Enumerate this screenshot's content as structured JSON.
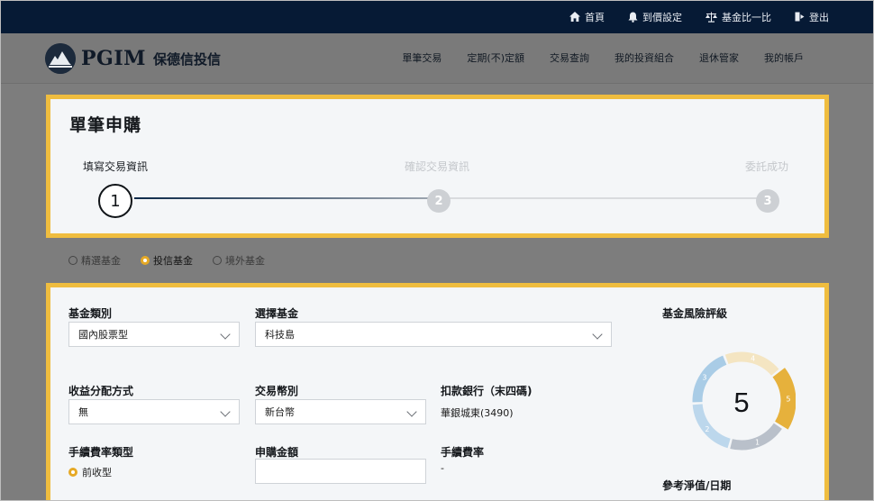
{
  "topbar": {
    "links": [
      {
        "label": "首頁",
        "icon": "home-icon"
      },
      {
        "label": "到價設定",
        "icon": "bell-icon"
      },
      {
        "label": "基金比一比",
        "icon": "scale-icon"
      },
      {
        "label": "登出",
        "icon": "logout-icon"
      }
    ]
  },
  "brand": {
    "name": "PGIM",
    "sub": "保德信投信"
  },
  "nav": {
    "items": [
      "單筆交易",
      "定期(不)定額",
      "交易查詢",
      "我的投資組合",
      "退休管家",
      "我的帳戶"
    ]
  },
  "page": {
    "title": "單筆申購"
  },
  "steps": [
    {
      "num": "1",
      "label": "填寫交易資訊",
      "state": "active"
    },
    {
      "num": "2",
      "label": "確認交易資訊",
      "state": "inactive"
    },
    {
      "num": "3",
      "label": "委託成功",
      "state": "inactive"
    }
  ],
  "fund_types": {
    "options": [
      "精選基金",
      "投信基金",
      "境外基金"
    ],
    "selected": "投信基金"
  },
  "form": {
    "category_label": "基金類別",
    "category_value": "國內股票型",
    "fund_label": "選擇基金",
    "fund_value": "科技島",
    "dist_label": "收益分配方式",
    "dist_value": "無",
    "currency_label": "交易幣別",
    "currency_value": "新台幣",
    "bank_label": "扣款銀行（末四碼)",
    "bank_value": "華銀城東(3490)",
    "fee_type_label": "手續費率類型",
    "fee_type_value": "前收型",
    "amount_label": "申購金額",
    "amount_value": "",
    "fee_rate_label": "手續費率",
    "fee_rate_value": "-"
  },
  "risk": {
    "title": "基金風險評級",
    "level": "5",
    "segments": [
      {
        "num": "1",
        "color": "#b9c0ca"
      },
      {
        "num": "2",
        "color": "#bcd7ec"
      },
      {
        "num": "3",
        "color": "#a9cce6"
      },
      {
        "num": "4",
        "color": "#f4e5c2"
      },
      {
        "num": "5",
        "color": "#e6b13c"
      }
    ]
  },
  "nav_value": {
    "title": "參考淨值/日期"
  }
}
